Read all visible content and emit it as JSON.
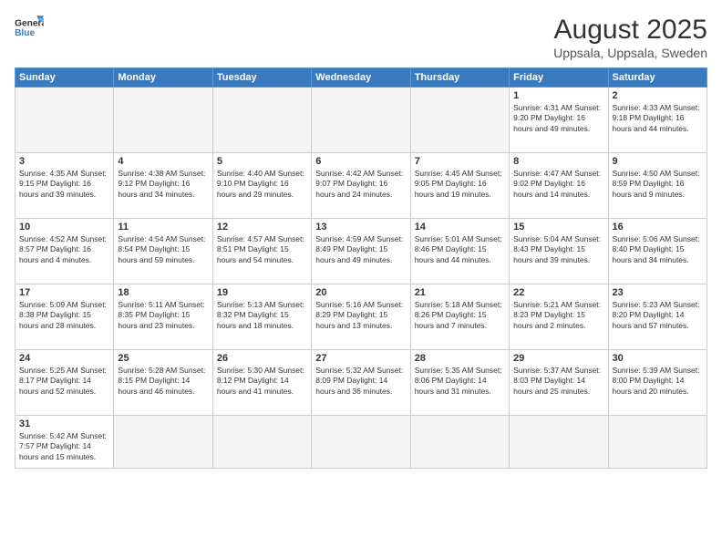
{
  "header": {
    "logo_general": "General",
    "logo_blue": "Blue",
    "month_year": "August 2025",
    "location": "Uppsala, Uppsala, Sweden"
  },
  "weekdays": [
    "Sunday",
    "Monday",
    "Tuesday",
    "Wednesday",
    "Thursday",
    "Friday",
    "Saturday"
  ],
  "weeks": [
    [
      {
        "num": "",
        "info": ""
      },
      {
        "num": "",
        "info": ""
      },
      {
        "num": "",
        "info": ""
      },
      {
        "num": "",
        "info": ""
      },
      {
        "num": "",
        "info": ""
      },
      {
        "num": "1",
        "info": "Sunrise: 4:31 AM\nSunset: 9:20 PM\nDaylight: 16 hours\nand 49 minutes."
      },
      {
        "num": "2",
        "info": "Sunrise: 4:33 AM\nSunset: 9:18 PM\nDaylight: 16 hours\nand 44 minutes."
      }
    ],
    [
      {
        "num": "3",
        "info": "Sunrise: 4:35 AM\nSunset: 9:15 PM\nDaylight: 16 hours\nand 39 minutes."
      },
      {
        "num": "4",
        "info": "Sunrise: 4:38 AM\nSunset: 9:12 PM\nDaylight: 16 hours\nand 34 minutes."
      },
      {
        "num": "5",
        "info": "Sunrise: 4:40 AM\nSunset: 9:10 PM\nDaylight: 16 hours\nand 29 minutes."
      },
      {
        "num": "6",
        "info": "Sunrise: 4:42 AM\nSunset: 9:07 PM\nDaylight: 16 hours\nand 24 minutes."
      },
      {
        "num": "7",
        "info": "Sunrise: 4:45 AM\nSunset: 9:05 PM\nDaylight: 16 hours\nand 19 minutes."
      },
      {
        "num": "8",
        "info": "Sunrise: 4:47 AM\nSunset: 9:02 PM\nDaylight: 16 hours\nand 14 minutes."
      },
      {
        "num": "9",
        "info": "Sunrise: 4:50 AM\nSunset: 8:59 PM\nDaylight: 16 hours\nand 9 minutes."
      }
    ],
    [
      {
        "num": "10",
        "info": "Sunrise: 4:52 AM\nSunset: 8:57 PM\nDaylight: 16 hours\nand 4 minutes."
      },
      {
        "num": "11",
        "info": "Sunrise: 4:54 AM\nSunset: 8:54 PM\nDaylight: 15 hours\nand 59 minutes."
      },
      {
        "num": "12",
        "info": "Sunrise: 4:57 AM\nSunset: 8:51 PM\nDaylight: 15 hours\nand 54 minutes."
      },
      {
        "num": "13",
        "info": "Sunrise: 4:59 AM\nSunset: 8:49 PM\nDaylight: 15 hours\nand 49 minutes."
      },
      {
        "num": "14",
        "info": "Sunrise: 5:01 AM\nSunset: 8:46 PM\nDaylight: 15 hours\nand 44 minutes."
      },
      {
        "num": "15",
        "info": "Sunrise: 5:04 AM\nSunset: 8:43 PM\nDaylight: 15 hours\nand 39 minutes."
      },
      {
        "num": "16",
        "info": "Sunrise: 5:06 AM\nSunset: 8:40 PM\nDaylight: 15 hours\nand 34 minutes."
      }
    ],
    [
      {
        "num": "17",
        "info": "Sunrise: 5:09 AM\nSunset: 8:38 PM\nDaylight: 15 hours\nand 28 minutes."
      },
      {
        "num": "18",
        "info": "Sunrise: 5:11 AM\nSunset: 8:35 PM\nDaylight: 15 hours\nand 23 minutes."
      },
      {
        "num": "19",
        "info": "Sunrise: 5:13 AM\nSunset: 8:32 PM\nDaylight: 15 hours\nand 18 minutes."
      },
      {
        "num": "20",
        "info": "Sunrise: 5:16 AM\nSunset: 8:29 PM\nDaylight: 15 hours\nand 13 minutes."
      },
      {
        "num": "21",
        "info": "Sunrise: 5:18 AM\nSunset: 8:26 PM\nDaylight: 15 hours\nand 7 minutes."
      },
      {
        "num": "22",
        "info": "Sunrise: 5:21 AM\nSunset: 8:23 PM\nDaylight: 15 hours\nand 2 minutes."
      },
      {
        "num": "23",
        "info": "Sunrise: 5:23 AM\nSunset: 8:20 PM\nDaylight: 14 hours\nand 57 minutes."
      }
    ],
    [
      {
        "num": "24",
        "info": "Sunrise: 5:25 AM\nSunset: 8:17 PM\nDaylight: 14 hours\nand 52 minutes."
      },
      {
        "num": "25",
        "info": "Sunrise: 5:28 AM\nSunset: 8:15 PM\nDaylight: 14 hours\nand 46 minutes."
      },
      {
        "num": "26",
        "info": "Sunrise: 5:30 AM\nSunset: 8:12 PM\nDaylight: 14 hours\nand 41 minutes."
      },
      {
        "num": "27",
        "info": "Sunrise: 5:32 AM\nSunset: 8:09 PM\nDaylight: 14 hours\nand 36 minutes."
      },
      {
        "num": "28",
        "info": "Sunrise: 5:35 AM\nSunset: 8:06 PM\nDaylight: 14 hours\nand 31 minutes."
      },
      {
        "num": "29",
        "info": "Sunrise: 5:37 AM\nSunset: 8:03 PM\nDaylight: 14 hours\nand 25 minutes."
      },
      {
        "num": "30",
        "info": "Sunrise: 5:39 AM\nSunset: 8:00 PM\nDaylight: 14 hours\nand 20 minutes."
      }
    ],
    [
      {
        "num": "31",
        "info": "Sunrise: 5:42 AM\nSunset: 7:57 PM\nDaylight: 14 hours\nand 15 minutes."
      },
      {
        "num": "",
        "info": ""
      },
      {
        "num": "",
        "info": ""
      },
      {
        "num": "",
        "info": ""
      },
      {
        "num": "",
        "info": ""
      },
      {
        "num": "",
        "info": ""
      },
      {
        "num": "",
        "info": ""
      }
    ]
  ]
}
